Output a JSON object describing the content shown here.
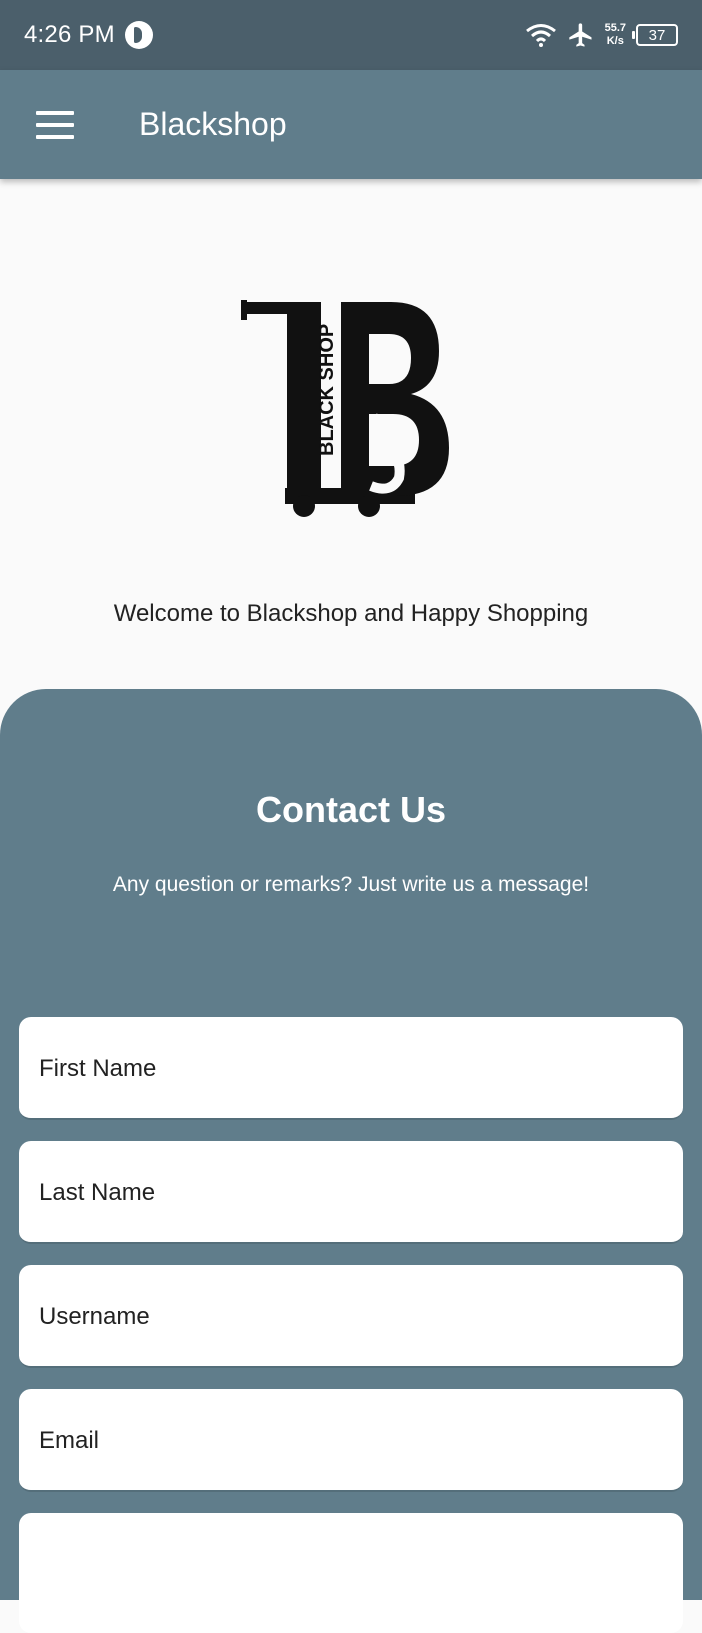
{
  "status_bar": {
    "time": "4:26 PM",
    "speed_value": "55.7",
    "speed_unit": "K/s",
    "battery": "37"
  },
  "app_bar": {
    "title": "Blackshop"
  },
  "logo": {
    "text": "BLACK SHOP"
  },
  "welcome_text": "Welcome to Blackshop and Happy Shopping",
  "contact": {
    "title": "Contact Us",
    "subtitle": "Any question or remarks? Just write us a message!",
    "fields": [
      {
        "placeholder": "First Name"
      },
      {
        "placeholder": "Last Name"
      },
      {
        "placeholder": "Username"
      },
      {
        "placeholder": "Email"
      },
      {
        "placeholder": ""
      }
    ]
  },
  "colors": {
    "status_bar": "#4b5f6b",
    "primary": "#607d8b",
    "background": "#fafafa"
  }
}
